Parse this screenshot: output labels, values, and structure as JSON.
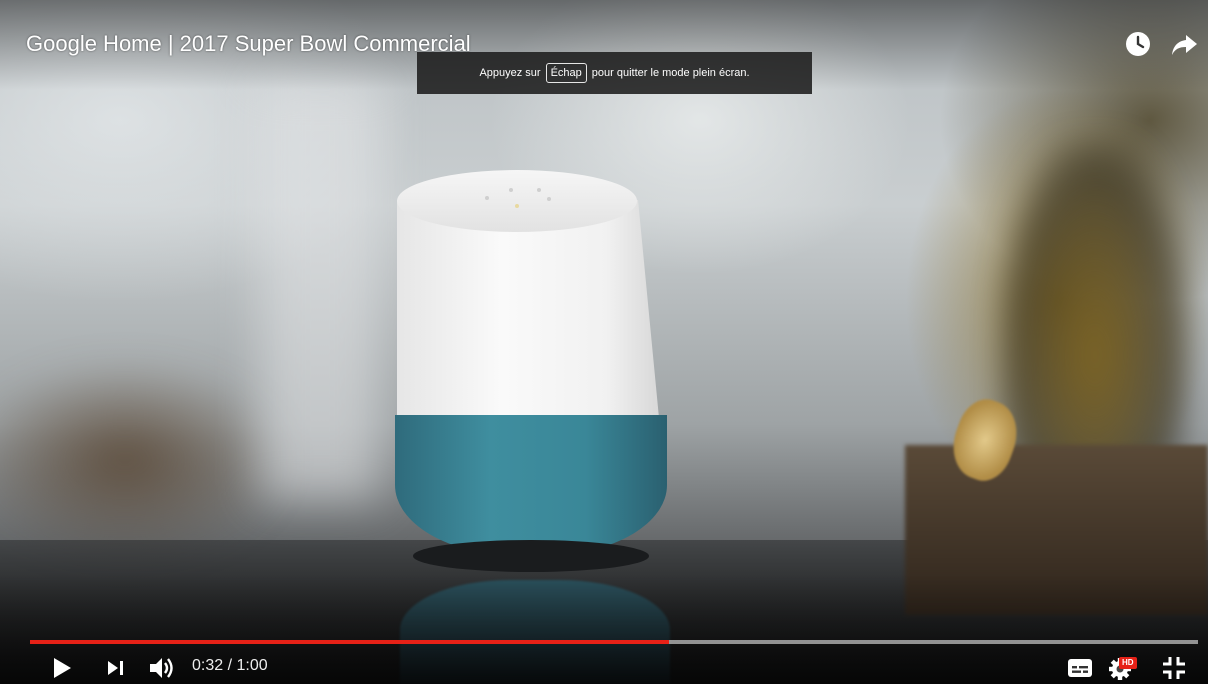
{
  "video": {
    "title": "Google Home | 2017 Super Bowl Commercial"
  },
  "fullscreen_notice": {
    "before": "Appuyez sur",
    "key": "Échap",
    "after": "pour quitter le mode plein écran."
  },
  "player": {
    "current_time": "0:32",
    "separator": "/",
    "duration": "1:00",
    "progress_fraction": 0.5467,
    "progress_color": "#e62117",
    "quality_badge": "HD"
  },
  "icons": {
    "watch_later": "clock-icon",
    "share": "share-arrow-icon",
    "play": "play-icon",
    "next": "next-icon",
    "volume": "volume-icon",
    "subtitles": "subtitles-icon",
    "settings": "gear-icon",
    "exit_fullscreen": "exit-fullscreen-icon"
  }
}
